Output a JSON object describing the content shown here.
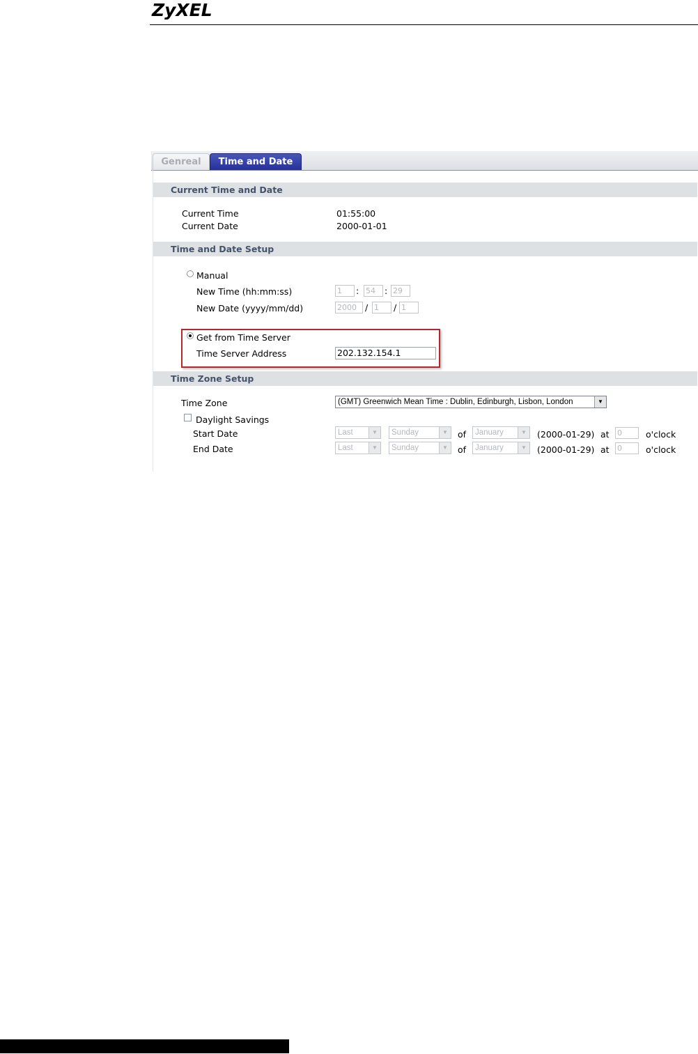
{
  "brand": {
    "logo": "ZyXEL"
  },
  "tabs": [
    {
      "label": "Genreal",
      "active": false
    },
    {
      "label": "Time and Date",
      "active": true
    }
  ],
  "current": {
    "header": "Current Time and Date",
    "time_label": "Current Time",
    "time_value": "01:55:00",
    "date_label": "Current Date",
    "date_value": "2000-01-01"
  },
  "setup": {
    "header": "Time and Date Setup",
    "manual_label": "Manual",
    "new_time_label": "New Time (hh:mm:ss)",
    "new_time": {
      "hh": "1",
      "mm": "54",
      "ss": "29"
    },
    "new_date_label": "New Date (yyyy/mm/dd)",
    "new_date": {
      "yyyy": "2000",
      "mm": "1",
      "dd": "1"
    },
    "server_label": "Get from Time Server",
    "server_addr_label": "Time Server Address",
    "server_addr_value": "202.132.154.1",
    "selected_mode": "server"
  },
  "zone": {
    "header": "Time Zone Setup",
    "tz_label": "Time Zone",
    "tz_value": "(GMT) Greenwich Mean Time : Dublin, Edinburgh, Lisbon, London",
    "dst_label": "Daylight Savings",
    "dst_checked": false,
    "start_label": "Start Date",
    "end_label": "End Date",
    "start": {
      "week": "Last",
      "day": "Sunday",
      "of": "of",
      "month": "January",
      "date": "(2000-01-29)",
      "at": "at",
      "hour": "0",
      "oclock": "o'clock"
    },
    "end": {
      "week": "Last",
      "day": "Sunday",
      "of": "of",
      "month": "January",
      "date": "(2000-01-29)",
      "at": "at",
      "hour": "0",
      "oclock": "o'clock"
    }
  },
  "colors": {
    "tab_active": "#2b369e",
    "section_bg": "#dde1e4",
    "highlight": "#b6262c"
  },
  "icons": {
    "dropdown": "chevron-down-icon"
  }
}
